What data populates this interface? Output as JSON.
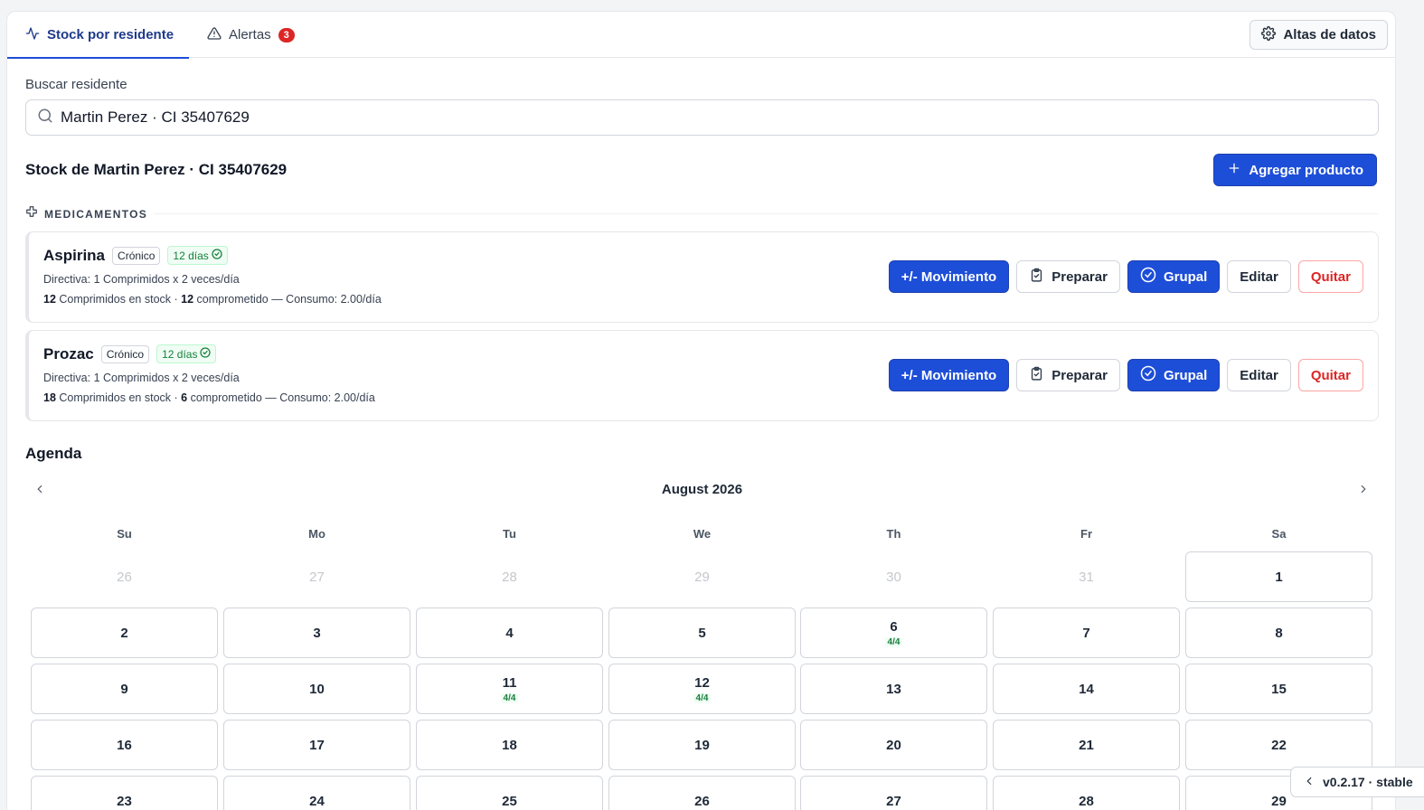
{
  "tabs": [
    {
      "label": "Stock por residente",
      "icon": "activity-icon",
      "active": true
    },
    {
      "label": "Alertas",
      "icon": "alert-triangle-icon",
      "badge": "3"
    }
  ],
  "header": {
    "altas_label": "Altas de datos"
  },
  "search": {
    "label": "Buscar residente",
    "value": "Martin Perez · CI 35407629"
  },
  "stock": {
    "title": "Stock de Martin Perez · CI 35407629",
    "add_label": "Agregar producto"
  },
  "section": {
    "label": "MEDICAMENTOS"
  },
  "medications": [
    {
      "name": "Aspirina",
      "type": "Crónico",
      "days": "12 días",
      "directive": "Directiva: 1 Comprimidos x 2 veces/día",
      "stock_qty": "12",
      "stock_text": " Comprimidos en stock · ",
      "committed_qty": "12",
      "committed_text": " comprometido — Consumo: 2.00/día"
    },
    {
      "name": "Prozac",
      "type": "Crónico",
      "days": "12 días",
      "directive": "Directiva: 1 Comprimidos x 2 veces/día",
      "stock_qty": "18",
      "stock_text": " Comprimidos en stock · ",
      "committed_qty": "6",
      "committed_text": " comprometido — Consumo: 2.00/día"
    }
  ],
  "actions": {
    "movimiento": "+/- Movimiento",
    "preparar": "Preparar",
    "grupal": "Grupal",
    "editar": "Editar",
    "quitar": "Quitar"
  },
  "agenda": {
    "title": "Agenda",
    "month": "August 2026",
    "weekdays": [
      "Su",
      "Mo",
      "Tu",
      "We",
      "Th",
      "Fr",
      "Sa"
    ],
    "weeks": [
      [
        {
          "d": "26",
          "out": true
        },
        {
          "d": "27",
          "out": true
        },
        {
          "d": "28",
          "out": true
        },
        {
          "d": "29",
          "out": true
        },
        {
          "d": "30",
          "out": true
        },
        {
          "d": "31",
          "out": true
        },
        {
          "d": "1"
        }
      ],
      [
        {
          "d": "2"
        },
        {
          "d": "3"
        },
        {
          "d": "4"
        },
        {
          "d": "5"
        },
        {
          "d": "6",
          "dose": "4/4"
        },
        {
          "d": "7"
        },
        {
          "d": "8"
        }
      ],
      [
        {
          "d": "9"
        },
        {
          "d": "10"
        },
        {
          "d": "11",
          "dose": "4/4"
        },
        {
          "d": "12",
          "dose": "4/4"
        },
        {
          "d": "13"
        },
        {
          "d": "14"
        },
        {
          "d": "15"
        }
      ],
      [
        {
          "d": "16"
        },
        {
          "d": "17"
        },
        {
          "d": "18"
        },
        {
          "d": "19"
        },
        {
          "d": "20"
        },
        {
          "d": "21"
        },
        {
          "d": "22"
        }
      ],
      [
        {
          "d": "23"
        },
        {
          "d": "24"
        },
        {
          "d": "25"
        },
        {
          "d": "26"
        },
        {
          "d": "27"
        },
        {
          "d": "28"
        },
        {
          "d": "29"
        }
      ]
    ]
  },
  "version": {
    "label": "v0.2.17 · stable"
  },
  "colors": {
    "primary": "#1d4ed8",
    "danger": "#dc2626",
    "success": "#15803d"
  }
}
